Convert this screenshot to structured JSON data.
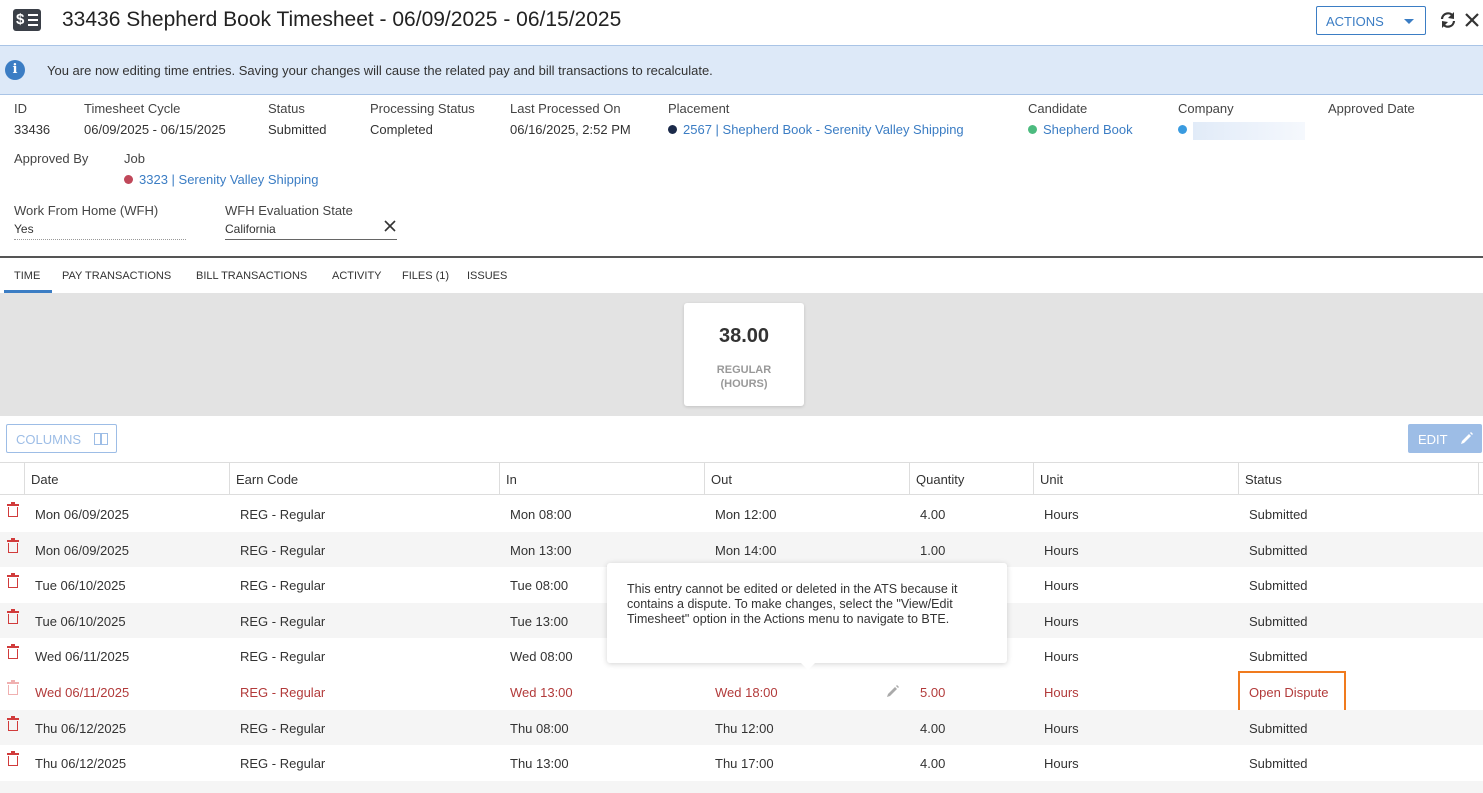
{
  "header": {
    "title": "33436  Shepherd Book Timesheet - 06/09/2025 - 06/15/2025",
    "actions_label": "ACTIONS"
  },
  "banner": {
    "text": "You are now editing time entries. Saving your changes will cause the related pay and bill transactions to recalculate."
  },
  "details": {
    "id": {
      "label": "ID",
      "value": "33436"
    },
    "cycle": {
      "label": "Timesheet Cycle",
      "value": "06/09/2025 - 06/15/2025"
    },
    "status": {
      "label": "Status",
      "value": "Submitted"
    },
    "processing": {
      "label": "Processing Status",
      "value": "Completed"
    },
    "last_processed": {
      "label": "Last Processed On",
      "value": "06/16/2025, 2:52 PM"
    },
    "placement": {
      "label": "Placement",
      "value": "2567 | Shepherd Book - Serenity Valley Shipping",
      "dot_color": "#1b2a4a"
    },
    "candidate": {
      "label": "Candidate",
      "value": "Shepherd Book",
      "dot_color": "#4cbb7f"
    },
    "company": {
      "label": "Company",
      "dot_color": "#3a9be0"
    },
    "approved_date": {
      "label": "Approved Date"
    },
    "approved_by": {
      "label": "Approved By"
    },
    "job": {
      "label": "Job",
      "value": "3323 | Serenity Valley Shipping",
      "dot_color": "#c0485a"
    },
    "wfh": {
      "label": "Work From Home (WFH)",
      "value": "Yes"
    },
    "wfh_state": {
      "label": "WFH Evaluation State",
      "value": "California"
    }
  },
  "tabs": [
    "TIME",
    "PAY TRANSACTIONS",
    "BILL TRANSACTIONS",
    "ACTIVITY",
    "FILES (1)",
    "ISSUES"
  ],
  "summary": {
    "value": "38.00",
    "unit_line1": "REGULAR",
    "unit_line2": "(HOURS)"
  },
  "toolbar": {
    "columns_label": "COLUMNS",
    "edit_label": "EDIT"
  },
  "table": {
    "headers": [
      "Date",
      "Earn Code",
      "In",
      "Out",
      "Quantity",
      "Unit",
      "Status"
    ],
    "rows": [
      {
        "date": "Mon 06/09/2025",
        "earn": "REG - Regular",
        "in": "Mon 08:00",
        "out": "Mon 12:00",
        "qty": "4.00",
        "unit": "Hours",
        "status": "Submitted"
      },
      {
        "date": "Mon 06/09/2025",
        "earn": "REG - Regular",
        "in": "Mon 13:00",
        "out": "Mon 14:00",
        "qty": "1.00",
        "unit": "Hours",
        "status": "Submitted"
      },
      {
        "date": "Tue 06/10/2025",
        "earn": "REG - Regular",
        "in": "Tue 08:00",
        "out": "",
        "qty": "",
        "unit": "Hours",
        "status": "Submitted"
      },
      {
        "date": "Tue 06/10/2025",
        "earn": "REG - Regular",
        "in": "Tue 13:00",
        "out": "",
        "qty": "",
        "unit": "Hours",
        "status": "Submitted"
      },
      {
        "date": "Wed 06/11/2025",
        "earn": "REG - Regular",
        "in": "Wed 08:00",
        "out": "",
        "qty": "",
        "unit": "Hours",
        "status": "Submitted"
      },
      {
        "date": "Wed 06/11/2025",
        "earn": "REG - Regular",
        "in": "Wed 13:00",
        "out": "Wed 18:00",
        "qty": "5.00",
        "unit": "Hours",
        "status": "Open Dispute"
      },
      {
        "date": "Thu 06/12/2025",
        "earn": "REG - Regular",
        "in": "Thu 08:00",
        "out": "Thu 12:00",
        "qty": "4.00",
        "unit": "Hours",
        "status": "Submitted"
      },
      {
        "date": "Thu 06/12/2025",
        "earn": "REG - Regular",
        "in": "Thu 13:00",
        "out": "Thu 17:00",
        "qty": "4.00",
        "unit": "Hours",
        "status": "Submitted"
      }
    ]
  },
  "tooltip": {
    "text": "This entry cannot be edited or deleted in the ATS because it contains a dispute. To make changes, select the \"View/Edit Timesheet\" option in the Actions menu to navigate to BTE."
  },
  "colors": {
    "accent": "#3b7dc4",
    "dispute": "#b23a3a",
    "highlight": "#f07b1e"
  }
}
